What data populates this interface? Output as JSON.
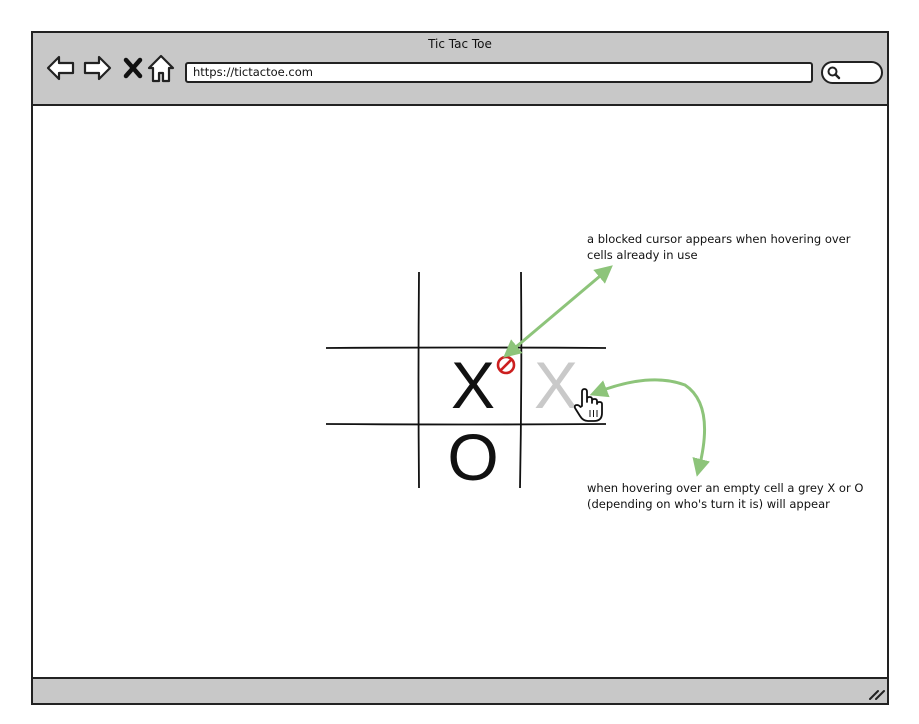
{
  "window": {
    "title": "Tic Tac Toe"
  },
  "toolbar": {
    "back_icon": "back-arrow-icon",
    "forward_icon": "forward-arrow-icon",
    "stop_icon": "close-icon",
    "home_icon": "home-icon"
  },
  "address_bar": {
    "url": "https://tictactoe.com"
  },
  "board": {
    "cells": [
      {
        "id": "r0c0",
        "mark": ""
      },
      {
        "id": "r0c1",
        "mark": ""
      },
      {
        "id": "r0c2",
        "mark": ""
      },
      {
        "id": "r1c0",
        "mark": ""
      },
      {
        "id": "r1c1",
        "mark": "X"
      },
      {
        "id": "r1c2",
        "mark": "X",
        "state": "hover-preview"
      },
      {
        "id": "r2c0",
        "mark": ""
      },
      {
        "id": "r2c1",
        "mark": "O"
      },
      {
        "id": "r2c2",
        "mark": ""
      }
    ]
  },
  "cursors": {
    "blocked": "blocked-cursor-icon",
    "hand": "hand-pointer-cursor-icon"
  },
  "annotations": {
    "blocked_note_line1": "a blocked cursor appears when hovering over",
    "blocked_note_line2": "cells already in use",
    "hover_note_line1": "when hovering over an empty cell a grey X or O",
    "hover_note_line2": "(depending on who's turn it is) will appear"
  },
  "colors": {
    "chrome": "#c8c8c8",
    "arrow": "#8dc47a",
    "blocked": "#cc1f1f",
    "preview_mark": "#c9c9c9"
  }
}
